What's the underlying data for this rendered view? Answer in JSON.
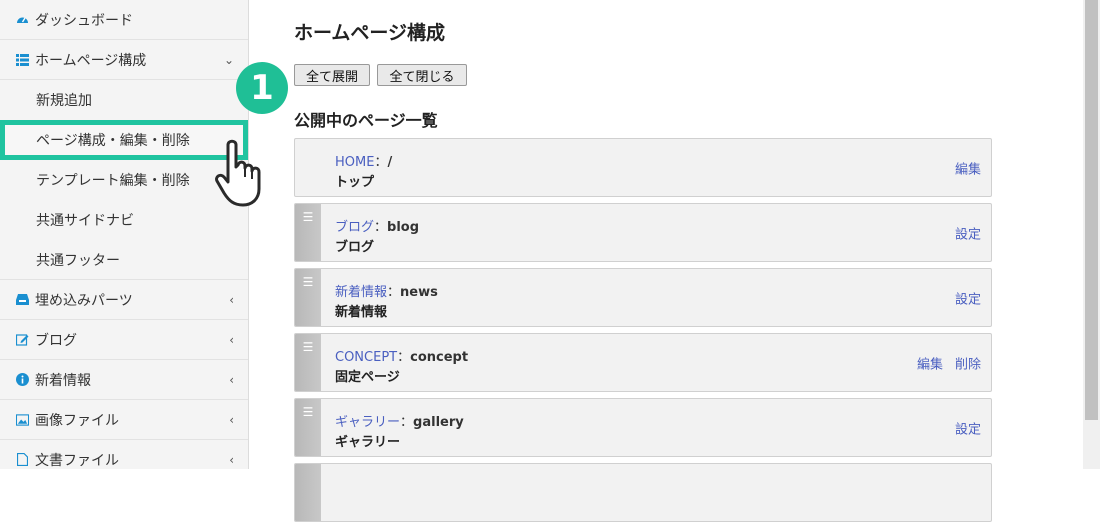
{
  "sidebar": {
    "items": [
      {
        "label": "ダッシュボード",
        "icon": "dashboard-icon",
        "chevron": ""
      },
      {
        "label": "ホームページ構成",
        "icon": "list-icon",
        "chevron": "⌄"
      },
      {
        "label": "埋め込みパーツ",
        "icon": "inbox-icon",
        "chevron": "‹"
      },
      {
        "label": "ブログ",
        "icon": "edit-icon",
        "chevron": "‹"
      },
      {
        "label": "新着情報",
        "icon": "info-icon",
        "chevron": "‹"
      },
      {
        "label": "画像ファイル",
        "icon": "image-icon",
        "chevron": "‹"
      },
      {
        "label": "文書ファイル",
        "icon": "file-icon",
        "chevron": "‹"
      }
    ],
    "subitems": [
      {
        "label": "新規追加"
      },
      {
        "label": "ページ構成・編集・削除"
      },
      {
        "label": "テンプレート編集・削除"
      },
      {
        "label": "共通サイドナビ"
      },
      {
        "label": "共通フッター"
      }
    ]
  },
  "main": {
    "title": "ホームページ構成",
    "expand_all": "全て展開",
    "collapse_all": "全て閉じる",
    "section_title": "公開中のページ一覧",
    "rows": [
      {
        "link": "HOME",
        "sep": "：",
        "slug": "/",
        "name": "トップ",
        "actions": [
          "編集"
        ]
      },
      {
        "link": "ブログ",
        "sep": "：",
        "slug": "blog",
        "name": "ブログ",
        "actions": [
          "設定"
        ]
      },
      {
        "link": "新着情報",
        "sep": "：",
        "slug": "news",
        "name": "新着情報",
        "actions": [
          "設定"
        ]
      },
      {
        "link": "CONCEPT",
        "sep": "：",
        "slug": "concept",
        "name": "固定ページ",
        "actions": [
          "編集",
          "削除"
        ]
      },
      {
        "link": "ギャラリー",
        "sep": "：",
        "slug": "gallery",
        "name": "ギャラリー",
        "actions": [
          "設定"
        ]
      }
    ]
  },
  "step_badge": "1",
  "colors": {
    "accent": "#1fbf96",
    "link": "#4a5fc0",
    "icon": "#1a8fd0"
  }
}
